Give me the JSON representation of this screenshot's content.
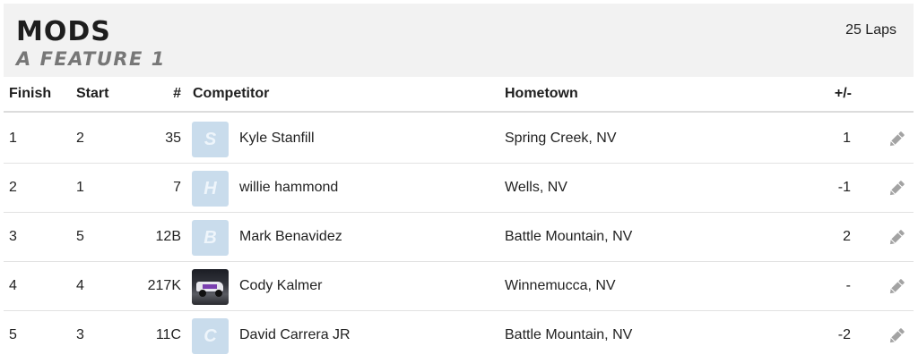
{
  "header": {
    "title": "MODS",
    "subtitle": "A FEATURE 1",
    "laps": "25 Laps"
  },
  "columns": {
    "finish": "Finish",
    "start": "Start",
    "number": "#",
    "competitor": "Competitor",
    "hometown": "Hometown",
    "plus_minus": "+/-"
  },
  "rows": [
    {
      "finish": "1",
      "start": "2",
      "number": "35",
      "avatar_letter": "S",
      "competitor": "Kyle Stanfill",
      "hometown": "Spring Creek, NV",
      "plus_minus": "1"
    },
    {
      "finish": "2",
      "start": "1",
      "number": "7",
      "avatar_letter": "H",
      "competitor": "willie hammond",
      "hometown": "Wells, NV",
      "plus_minus": "-1"
    },
    {
      "finish": "3",
      "start": "5",
      "number": "12B",
      "avatar_letter": "B",
      "competitor": "Mark Benavidez",
      "hometown": "Battle Mountain, NV",
      "plus_minus": "2"
    },
    {
      "finish": "4",
      "start": "4",
      "number": "217K",
      "avatar_letter": "",
      "competitor": "Cody Kalmer",
      "hometown": "Winnemucca, NV",
      "plus_minus": "-"
    },
    {
      "finish": "5",
      "start": "3",
      "number": "11C",
      "avatar_letter": "C",
      "competitor": "David Carrera JR",
      "hometown": "Battle Mountain, NV",
      "plus_minus": "-2"
    }
  ],
  "icons": {
    "edit": "pencil-icon",
    "avatar_photo": "race-car-photo"
  },
  "colors": {
    "header_bg": "#f2f2f2",
    "avatar_placeholder": "#c9dcec",
    "icon_gray": "#999999"
  }
}
